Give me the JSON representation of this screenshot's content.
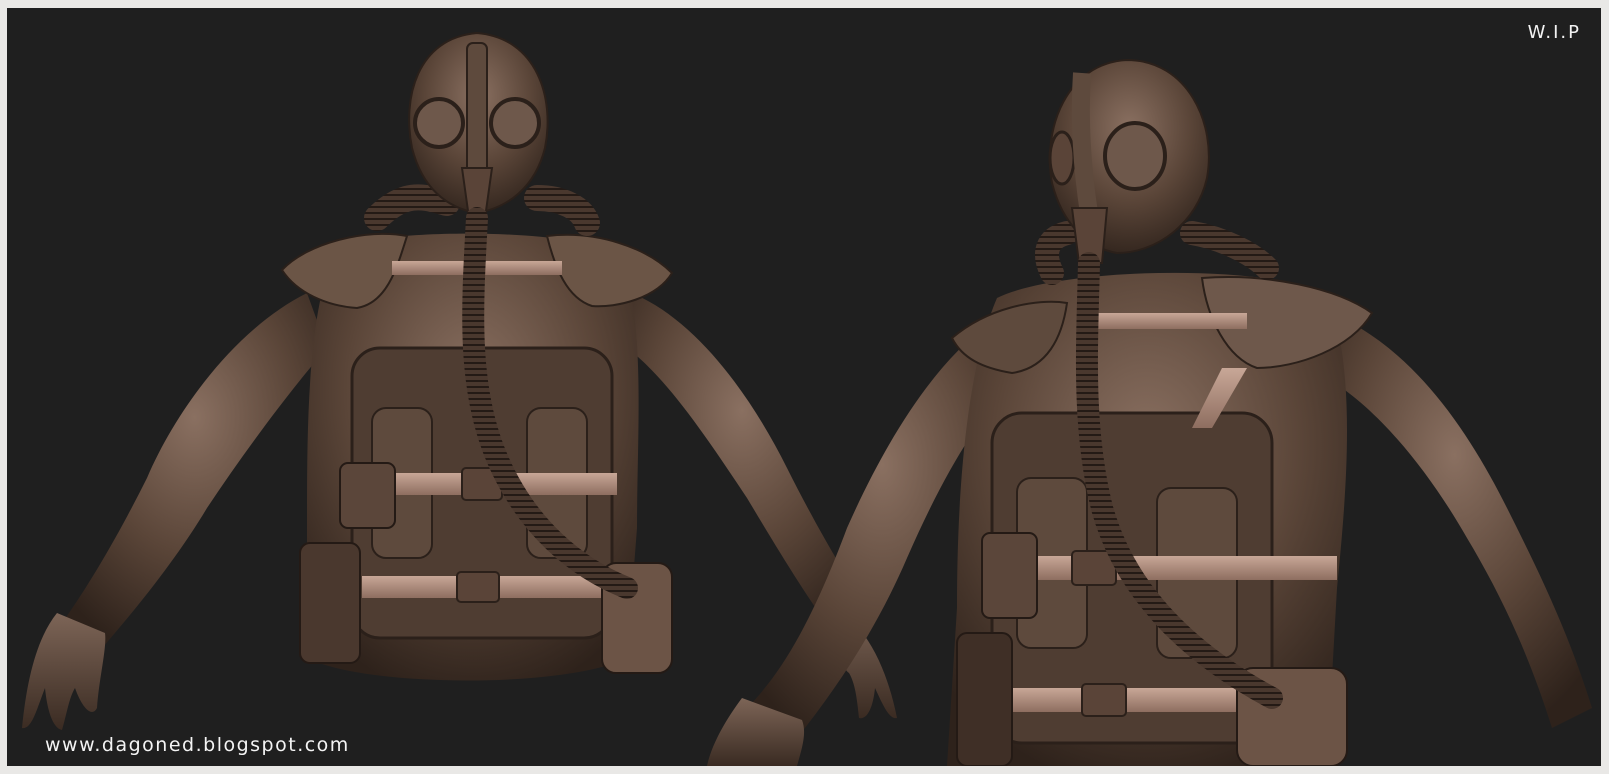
{
  "image": {
    "badge": "W.I.P",
    "watermark": "www.dagoned.blogspot.com",
    "colors": {
      "frame": "#e9e8e6",
      "background": "#1f1f1f",
      "material_dark": "#3b2b22",
      "material_mid": "#6b5546",
      "material_light": "#9e8475",
      "strap": "#b39181",
      "text": "#f4f4f4"
    },
    "subjects": [
      "gas-mask-figure-front",
      "gas-mask-figure-three-quarter"
    ]
  }
}
